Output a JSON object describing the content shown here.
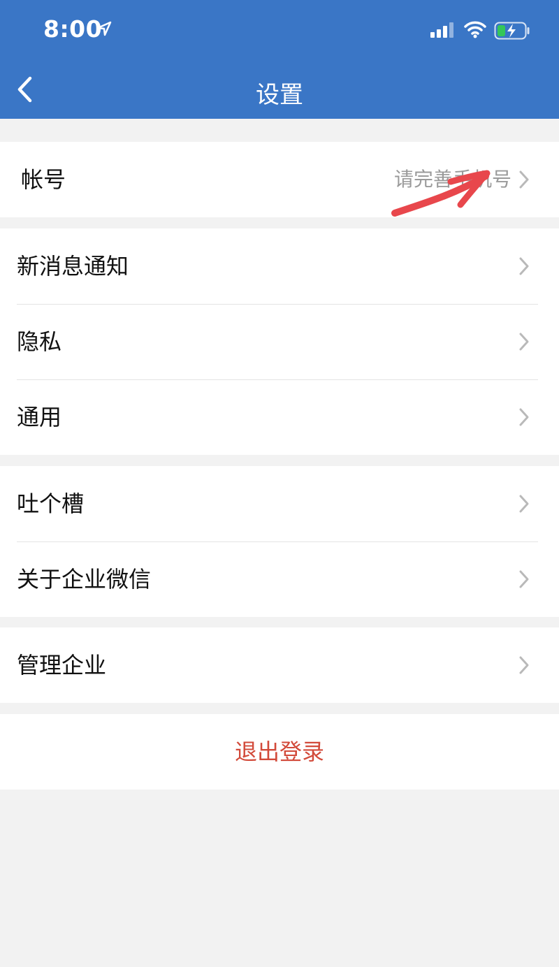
{
  "status_bar": {
    "time": "8:00"
  },
  "nav": {
    "title": "设置"
  },
  "sections": [
    {
      "items": [
        {
          "label": "帐号",
          "detail": "请完善手机号"
        }
      ]
    },
    {
      "items": [
        {
          "label": "新消息通知"
        },
        {
          "label": "隐私"
        },
        {
          "label": "通用"
        }
      ]
    },
    {
      "items": [
        {
          "label": "吐个槽"
        },
        {
          "label": "关于企业微信"
        }
      ]
    },
    {
      "items": [
        {
          "label": "管理企业"
        }
      ]
    }
  ],
  "logout_label": "退出登录",
  "colors": {
    "header_bg": "#3a76c6",
    "logout_text": "#d24a3a",
    "annotation_arrow": "#e8474c"
  },
  "icons": [
    "location-arrow-icon",
    "cellular-signal-icon",
    "wifi-icon",
    "battery-charging-icon",
    "back-chevron-icon",
    "chevron-right-icon"
  ]
}
